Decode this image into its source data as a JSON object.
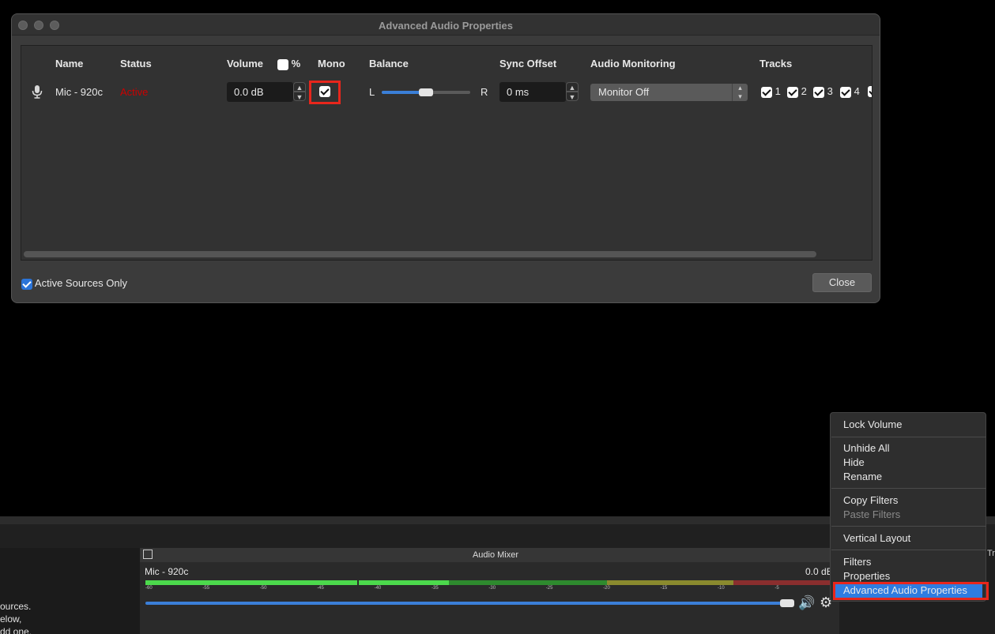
{
  "dialog": {
    "title": "Advanced Audio Properties",
    "columns": {
      "name": "Name",
      "status": "Status",
      "volume": "Volume",
      "percent": "%",
      "mono": "Mono",
      "balance": "Balance",
      "sync_offset": "Sync Offset",
      "audio_monitoring": "Audio Monitoring",
      "tracks": "Tracks"
    },
    "row": {
      "name": "Mic - 920c",
      "status": "Active",
      "volume": "0.0 dB",
      "mono_checked": true,
      "balance_left": "L",
      "balance_right": "R",
      "balance_value": 0.5,
      "sync_offset": "0 ms",
      "monitoring": "Monitor Off",
      "tracks": [
        "1",
        "2",
        "3",
        "4"
      ]
    },
    "active_sources_only": "Active Sources Only",
    "close_label": "Close"
  },
  "sources": {
    "text_lines": [
      "ources.",
      "elow,",
      "dd one."
    ]
  },
  "mixer": {
    "title": "Audio Mixer",
    "channel_name": "Mic - 920c",
    "channel_db": "0.0 dB",
    "ticks": [
      "-60",
      "-55",
      "-50",
      "-45",
      "-40",
      "-35",
      "-30",
      "-25",
      "-20",
      "-15",
      "-10",
      "-5"
    ],
    "side_tab": "Tr"
  },
  "context_menu": {
    "items": {
      "lock_volume": "Lock Volume",
      "unhide_all": "Unhide All",
      "hide": "Hide",
      "rename": "Rename",
      "copy_filters": "Copy Filters",
      "paste_filters": "Paste Filters",
      "vertical_layout": "Vertical Layout",
      "filters": "Filters",
      "properties": "Properties",
      "advanced_audio_properties": "Advanced Audio Properties"
    }
  },
  "colors": {
    "status_active": "#cc0000",
    "accent_blue": "#2f7ce0",
    "highlight_red": "#e8261c"
  }
}
